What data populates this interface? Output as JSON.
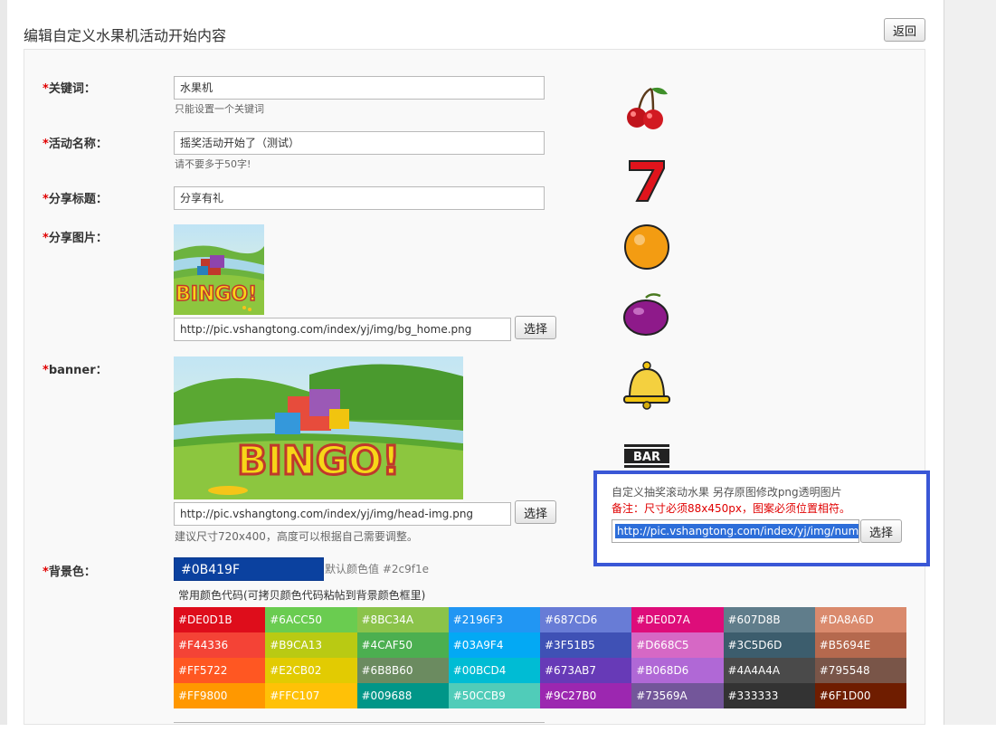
{
  "page": {
    "title": "编辑自定义水果机活动开始内容",
    "back_label": "返回"
  },
  "form": {
    "keyword": {
      "label": "关键词：",
      "value": "水果机",
      "hint": "只能设置一个关键词"
    },
    "activity_name": {
      "label": "活动名称：",
      "value": "摇奖活动开始了（测试）",
      "hint": "请不要多于50字!"
    },
    "share_title": {
      "label": "分享标题：",
      "value": "分享有礼"
    },
    "share_image": {
      "label": "分享图片：",
      "url": "http://pic.vshangtong.com/index/yj/img/bg_home.png",
      "button": "选择",
      "image_text": "BINGO!"
    },
    "banner": {
      "label": "banner：",
      "url": "http://pic.vshangtong.com/index/yj/img/head-img.png",
      "button": "选择",
      "hint": "建议尺寸720x400，高度可以根据自己需要调整。",
      "image_text": "BINGO!"
    },
    "bg_color": {
      "label": "背景色：",
      "value": "#0B419F",
      "default_label": "默认颜色值",
      "default_value": "#2c9f1e",
      "common_title": "常用颜色代码(可拷贝颜色代码粘帖到背景颜色框里)"
    },
    "required_mark": "*"
  },
  "swatches": [
    "#DE0D1B",
    "#6ACC50",
    "#8BC34A",
    "#2196F3",
    "#687CD6",
    "#DE0D7A",
    "#607D8B",
    "#DA8A6D",
    "#F44336",
    "#B9CA13",
    "#4CAF50",
    "#03A9F4",
    "#3F51B5",
    "#D668C5",
    "#3C5D6D",
    "#B5694E",
    "#FF5722",
    "#E2CB02",
    "#6B8B60",
    "#00BCD4",
    "#673AB7",
    "#B068D6",
    "#4A4A4A",
    "#795548",
    "#FF9800",
    "#FFC107",
    "#009688",
    "#50CCB9",
    "#9C27B0",
    "#73569A",
    "#333333",
    "#6F1D00"
  ],
  "fruits": [
    "cherry-icon",
    "seven-icon",
    "orange-icon",
    "plum-icon",
    "bell-icon",
    "bar-icon"
  ],
  "fruit_panel": {
    "description": "自定义抽奖滚动水果 另存原图修改png透明图片",
    "note": "备注：尺寸必须88x450px，图案必须位置相符。",
    "url": "http://pic.vshangtong.com/index/yj/img/num.",
    "button": "选择"
  }
}
